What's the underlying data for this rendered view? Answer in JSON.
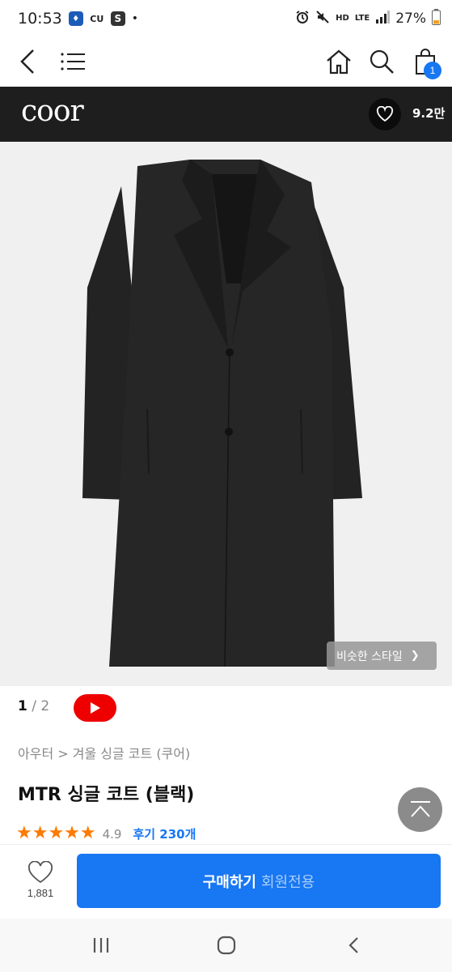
{
  "status_bar": {
    "time": "10:53",
    "app_icons": [
      "location-app-icon",
      "cu-app-icon",
      "s-app-icon"
    ],
    "cu_label": "CU",
    "s_label": "S",
    "hd_label": "HD",
    "lte_label": "LTE",
    "battery": "27%"
  },
  "nav": {
    "cart_count": "1"
  },
  "brand": {
    "name": "coor",
    "likes": "9.2만"
  },
  "product": {
    "similar_style_label": "비슷한 스타일",
    "page_current": "1",
    "page_separator": "/",
    "page_total": "2",
    "breadcrumb": "아우터 > 겨울 싱글 코트 (쿠어)",
    "title": "MTR 싱글 코트 (블랙)",
    "rating_value": 4.9,
    "rating_text": "4.9",
    "stars": "★★★★★",
    "review_label": "후기 230개"
  },
  "bottom_bar": {
    "wish_count": "1,881",
    "buy_label": "구매하기",
    "buy_sub_label": "회원전용"
  },
  "colors": {
    "accent_blue": "#1877f2",
    "brand_bar": "#1e1e1e",
    "star_orange": "#ff7a00",
    "youtube_red": "#ee0000"
  }
}
